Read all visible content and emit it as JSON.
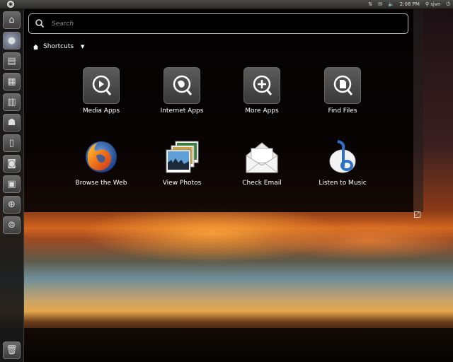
{
  "top_panel": {
    "network_icon": "network-updown-icon",
    "mail_icon": "envelope-icon",
    "volume_icon": "speaker-icon",
    "clock": "2:06 PM",
    "username": "sjvn"
  },
  "launcher": {
    "items": [
      {
        "name": "home-folder",
        "icon": "home-icon"
      },
      {
        "name": "firefox",
        "icon": "firefox-icon"
      },
      {
        "name": "libreoffice-writer",
        "icon": "document-icon"
      },
      {
        "name": "libreoffice-calc",
        "icon": "spreadsheet-icon"
      },
      {
        "name": "libreoffice-impress",
        "icon": "presentation-icon"
      },
      {
        "name": "software-center",
        "icon": "shopping-bag-icon"
      },
      {
        "name": "ubuntu-one",
        "icon": "clipboard-icon"
      },
      {
        "name": "camera-app",
        "icon": "camera-icon"
      },
      {
        "name": "workspace-switcher",
        "icon": "workspaces-icon"
      },
      {
        "name": "applications-lens",
        "icon": "apps-lens-icon"
      },
      {
        "name": "files-lens",
        "icon": "files-lens-icon"
      },
      {
        "name": "trash",
        "icon": "trash-icon"
      }
    ]
  },
  "search": {
    "placeholder": "Search"
  },
  "shortcuts": {
    "label": "Shortcuts"
  },
  "groups": [
    {
      "label": "Media Apps",
      "icon": "play-lens-icon"
    },
    {
      "label": "Internet Apps",
      "icon": "globe-lens-icon"
    },
    {
      "label": "More Apps",
      "icon": "plus-lens-icon"
    },
    {
      "label": "Find Files",
      "icon": "file-lens-icon"
    }
  ],
  "apps": [
    {
      "label": "Browse the Web",
      "icon": "firefox-icon"
    },
    {
      "label": "View Photos",
      "icon": "photos-icon"
    },
    {
      "label": "Check Email",
      "icon": "envelope-icon"
    },
    {
      "label": "Listen to Music",
      "icon": "music-note-icon"
    }
  ]
}
